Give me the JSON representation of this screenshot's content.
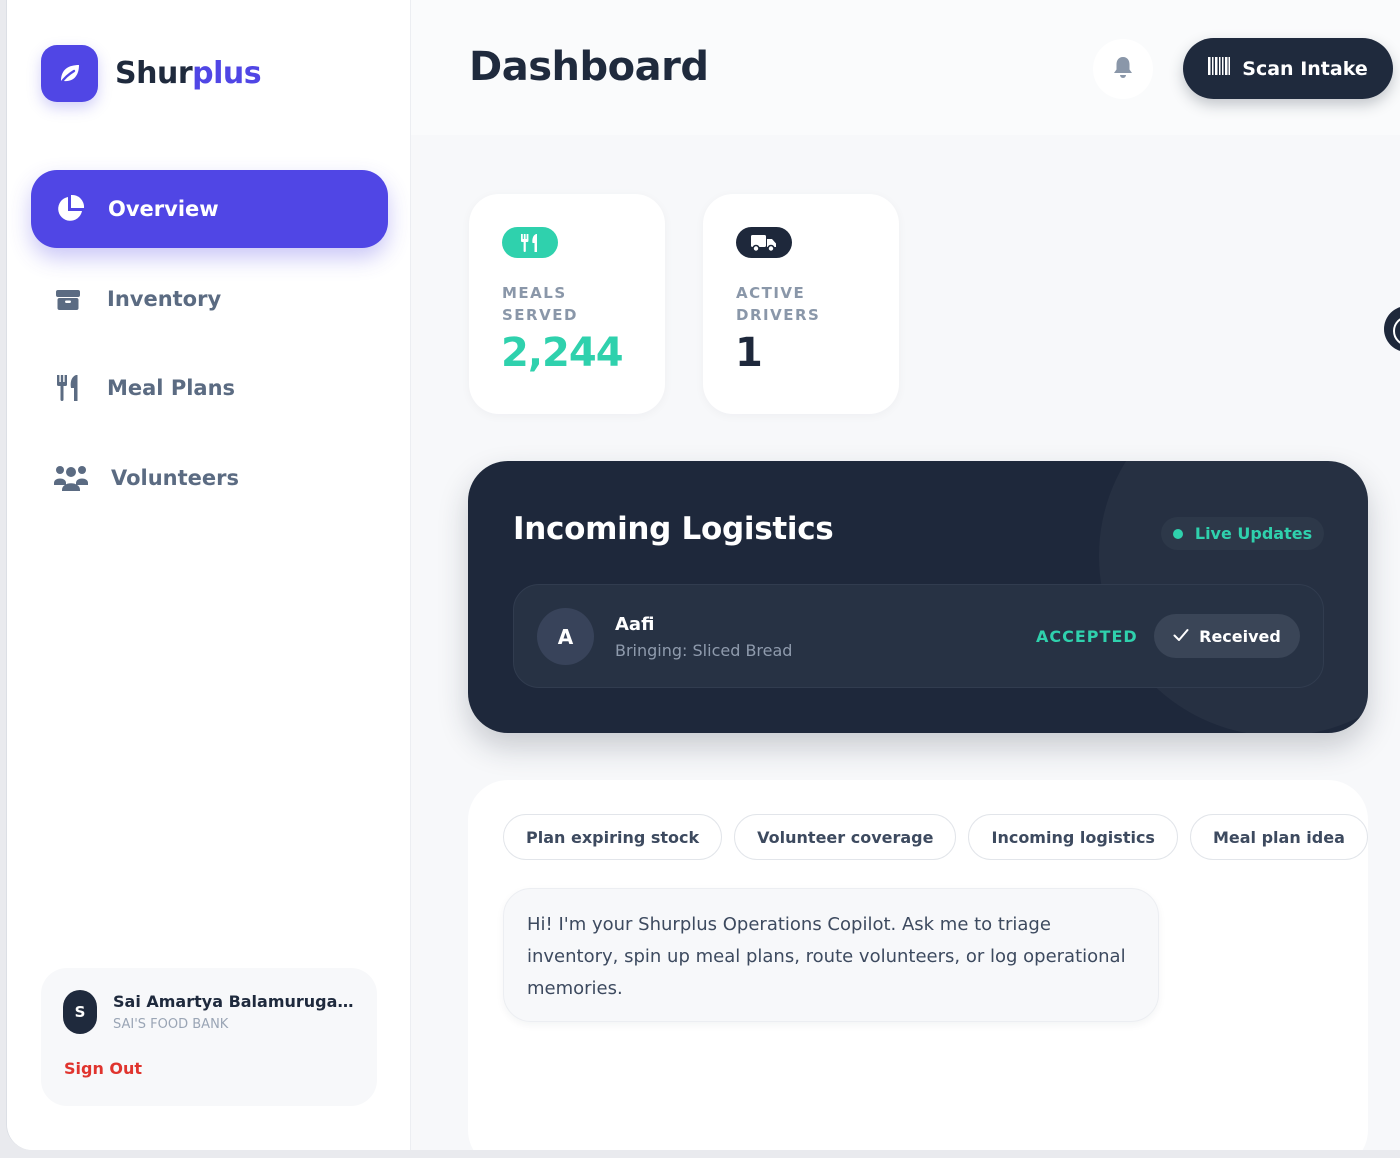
{
  "brand": {
    "name_part1": "Shur",
    "name_part2": "plus"
  },
  "sidebar": {
    "items": [
      {
        "label": "Overview",
        "icon": "pie-chart-icon",
        "active": true
      },
      {
        "label": "Inventory",
        "icon": "box-icon",
        "active": false
      },
      {
        "label": "Meal Plans",
        "icon": "utensils-icon",
        "active": false
      },
      {
        "label": "Volunteers",
        "icon": "users-icon",
        "active": false
      }
    ],
    "user": {
      "initial": "S",
      "name": "Sai Amartya Balamurugan L...",
      "org": "SAI'S FOOD BANK",
      "signout_label": "Sign Out"
    }
  },
  "header": {
    "title": "Dashboard",
    "scan_label": "Scan Intake"
  },
  "stats": [
    {
      "label": "MEALS SERVED",
      "value": "2,244",
      "icon": "utensils-icon",
      "color": "#2fd1ad"
    },
    {
      "label": "ACTIVE DRIVERS",
      "value": "1",
      "icon": "truck-icon",
      "color": "#1e283b"
    }
  ],
  "logistics": {
    "title": "Incoming Logistics",
    "live_label": "Live Updates",
    "deliveries": [
      {
        "initial": "A",
        "name": "Aafi",
        "item": "Bringing: Sliced Bread",
        "status": "ACCEPTED",
        "action_label": "Received"
      }
    ]
  },
  "copilot": {
    "chips": [
      "Plan expiring stock",
      "Volunteer coverage",
      "Incoming logistics",
      "Meal plan idea"
    ],
    "message": "Hi! I'm your Shurplus Operations Copilot. Ask me to triage inventory, spin up meal plans, route volunteers, or log operational memories."
  },
  "colors": {
    "accent": "#5046e5",
    "dark": "#1e283b",
    "teal": "#2fd1ad",
    "danger": "#e0342e"
  }
}
